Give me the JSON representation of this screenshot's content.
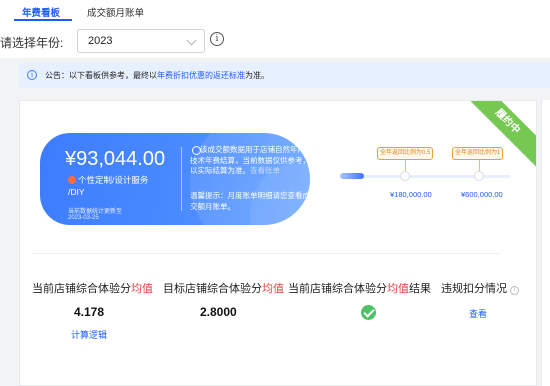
{
  "tabs": [
    {
      "label": "年费看板",
      "active": true
    },
    {
      "label": "成交额月账单",
      "active": false
    }
  ],
  "filter": {
    "label": "请选择年份:",
    "year_value": "2023"
  },
  "notice": {
    "prefix": "公告：以下看板供参考，最终以",
    "link": "年费折扣优惠的返还标准",
    "suffix": "为准。"
  },
  "status_ribbon": "履约中",
  "hero": {
    "amount": "¥93,044.00",
    "service_line1": "个性定制/设计服务",
    "service_line2": "/DIY",
    "update_label": "当前数据统计更新至",
    "update_date": "2023-03-25",
    "note_text_before": "该成交额数据用于店铺自然年内的技术年费结算，当前数据仅供参考，以实际结算为准。",
    "note_highlight": "查看账单",
    "tip_text": "温馨提示：月度账单明细请您查看成交额月账单。"
  },
  "progress": {
    "current_fraction": 0.14,
    "milestones": [
      {
        "tag": "全年返回比例为0.5",
        "amount": "¥180,000.00"
      },
      {
        "tag": "全年返回比例为1",
        "amount": "¥600,000.00"
      }
    ]
  },
  "metrics": [
    {
      "label_main": "当前店铺综合体验分",
      "label_highlight": "均值",
      "label_suffix": "",
      "value": "4.178",
      "link": "计算逻辑"
    },
    {
      "label_main": "目标店铺综合体验分",
      "label_highlight": "均值",
      "label_suffix": "",
      "value": "2.8000",
      "link": ""
    },
    {
      "label_main": "当前店铺综合体验分",
      "label_highlight": "均值",
      "label_suffix": "结果",
      "value": "",
      "link": ""
    },
    {
      "label_main": "违规扣分情况",
      "label_highlight": "",
      "label_suffix": "",
      "value": "",
      "link": "查看"
    }
  ],
  "colors": {
    "accent": "#1e5bff",
    "highlight_red": "#e54545",
    "success_green": "#4dc166",
    "ribbon_green": "#75c852",
    "tag_orange": "#e8821a"
  }
}
